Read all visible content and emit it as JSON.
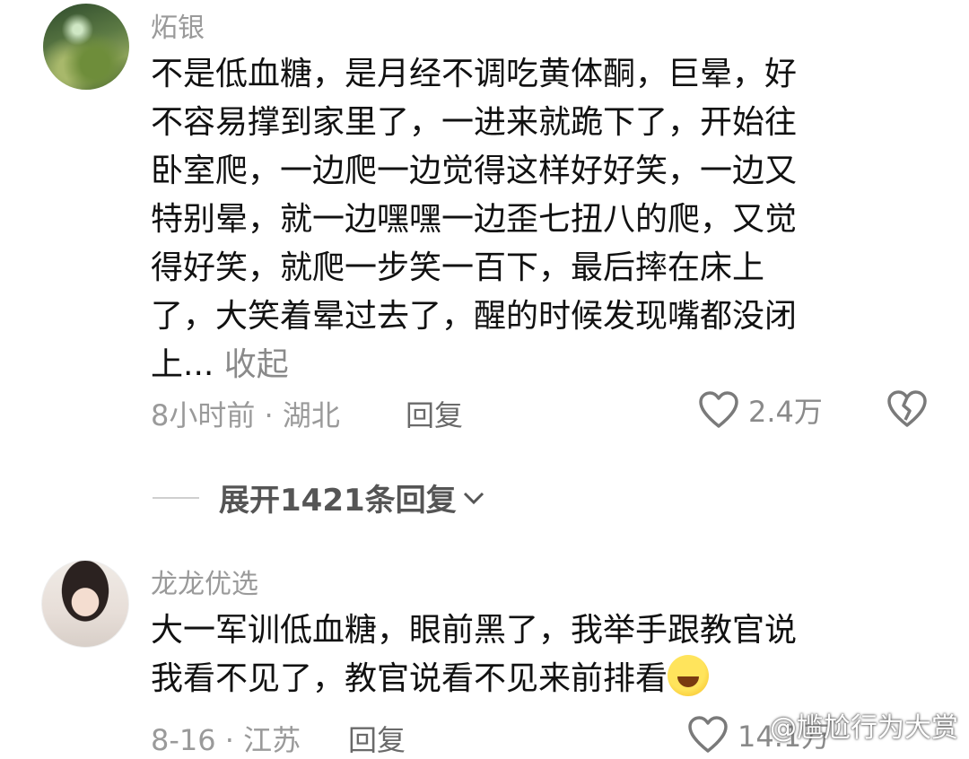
{
  "comments": [
    {
      "username": "炻银",
      "lines": [
        "不是低血糖，是月经不调吃黄体酮，巨晕，好",
        "不容易撑到家里了，一进来就跪下了，开始往",
        "卧室爬，一边爬一边觉得这样好好笑，一边又",
        "特别晕，就一边嘿嘿一边歪七扭八的爬，又觉",
        "得好笑，就爬一步笑一百下，最后摔在床上",
        "了，大笑着晕过去了，醒的时候发现嘴都没闭",
        "上..."
      ],
      "collapse_label": "收起",
      "meta": "8小时前 · 湖北",
      "reply_label": "回复",
      "likes": "2.4万"
    },
    {
      "username": "龙龙优选",
      "lines": [
        "大一军训低血糖，眼前黑了，我举手跟教官说",
        "我看不见了，教官说看不见来前排看"
      ],
      "meta": "8-16 · 江苏",
      "reply_label": "回复",
      "likes": "14.1万"
    }
  ],
  "expand_replies": "展开1421条回复",
  "watermark": "@尴尬行为大赏",
  "icons": {
    "like": "heart-outline-icon",
    "dislike": "broken-heart-icon",
    "expand": "chevron-down-icon",
    "emoji": "laughing-tears-emoji-icon"
  }
}
